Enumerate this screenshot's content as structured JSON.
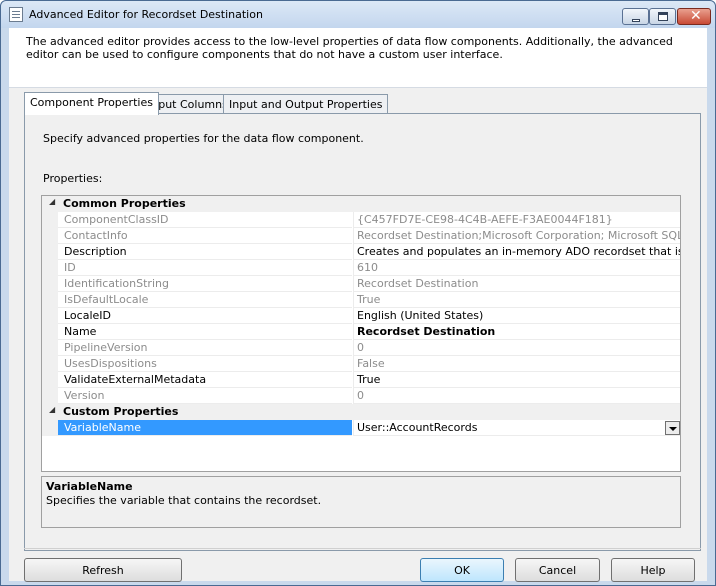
{
  "window": {
    "title": "Advanced Editor for Recordset Destination"
  },
  "intro_text": "The advanced editor provides access to the low-level properties of data flow components. Additionally, the advanced editor can be used to configure components that do not have a custom user interface.",
  "tabs": [
    {
      "label": "Component Properties",
      "active": true
    },
    {
      "label": "Input Columns",
      "active": false
    },
    {
      "label": "Input and Output Properties",
      "active": false
    }
  ],
  "panel": {
    "help_text": "Specify advanced properties for the data flow component.",
    "properties_label": "Properties:"
  },
  "categories": {
    "common": "Common Properties",
    "custom": "Custom Properties"
  },
  "properties": [
    {
      "name": "ComponentClassID",
      "value": "{C457FD7E-CE98-4C4B-AEFE-F3AE0044F181}"
    },
    {
      "name": "ContactInfo",
      "value": "Recordset Destination;Microsoft Corporation; Microsoft SQL Server; (C"
    },
    {
      "name": "Description",
      "value": "Creates and populates an in-memory ADO recordset that is available o"
    },
    {
      "name": "ID",
      "value": "610"
    },
    {
      "name": "IdentificationString",
      "value": "Recordset Destination"
    },
    {
      "name": "IsDefaultLocale",
      "value": "True"
    },
    {
      "name": "LocaleID",
      "value": "English (United States)"
    },
    {
      "name": "Name",
      "value": "Recordset Destination"
    },
    {
      "name": "PipelineVersion",
      "value": "0"
    },
    {
      "name": "UsesDispositions",
      "value": "False"
    },
    {
      "name": "ValidateExternalMetadata",
      "value": "True"
    },
    {
      "name": "Version",
      "value": "0"
    }
  ],
  "custom_properties": [
    {
      "name": "VariableName",
      "value": "User::AccountRecords",
      "selected": true
    }
  ],
  "help": {
    "title": "VariableName",
    "text": "Specifies the variable that contains the recordset."
  },
  "buttons": {
    "refresh": "Refresh",
    "ok": "OK",
    "cancel": "Cancel",
    "help": "Help"
  }
}
